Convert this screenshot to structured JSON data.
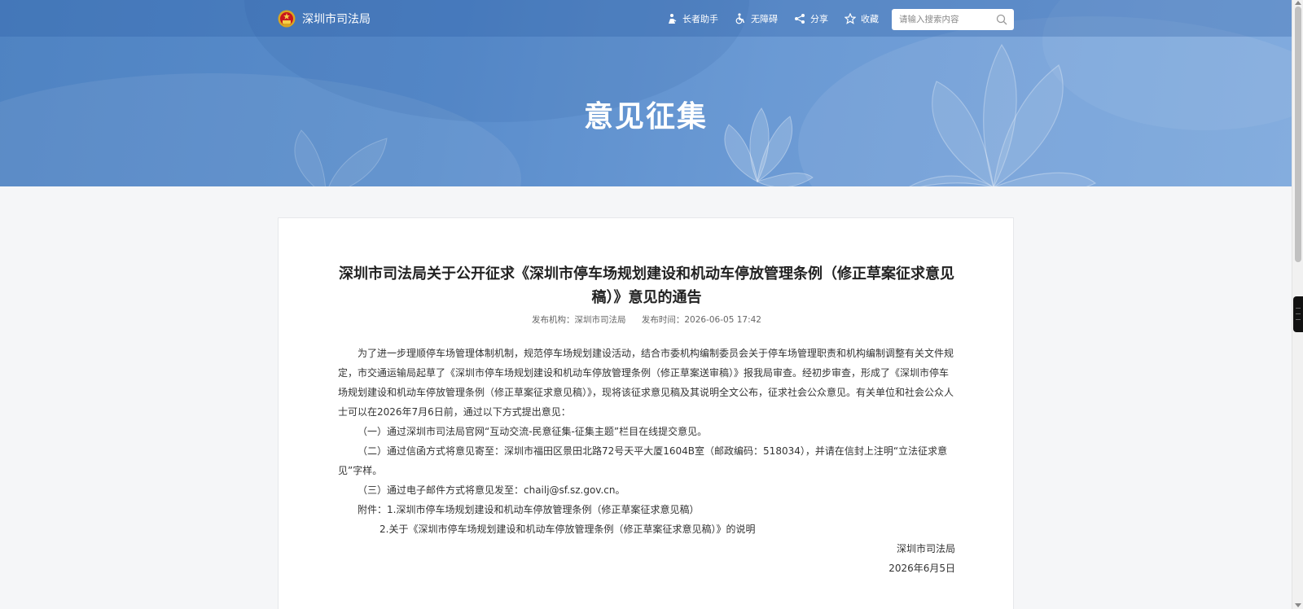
{
  "header": {
    "site_name": "深圳市司法局",
    "tools": [
      {
        "label": "长者助手",
        "icon": "elder-assist-icon"
      },
      {
        "label": "无障碍",
        "icon": "accessibility-icon"
      },
      {
        "label": "分享",
        "icon": "share-icon"
      },
      {
        "label": "收藏",
        "icon": "star-icon"
      }
    ],
    "search": {
      "placeholder": "请输入搜索内容",
      "icon": "search-icon"
    }
  },
  "banner": {
    "title": "意见征集"
  },
  "article": {
    "title": "深圳市司法局关于公开征求《深圳市停车场规划建设和机动车停放管理条例（修正草案征求意见稿）》意见的通告",
    "meta": {
      "publisher_label": "发布机构：",
      "publisher": "深圳市司法局",
      "time_label": "发布时间：",
      "time": "2026-06-05 17:42"
    },
    "intro": "为了进一步理顺停车场管理体制机制，规范停车场规划建设活动，结合市委机构编制委员会关于停车场管理职责和机构编制调整有关文件规定，市交通运输局起草了《深圳市停车场规划建设和机动车停放管理条例（修正草案送审稿）》报我局审查。经初步审查，形成了《深圳市停车场规划建设和机动车停放管理条例（修正草案征求意见稿）》，现将该征求意见稿及其说明全文公布，征求社会公众意见。有关单位和社会公众人士可以在2026年7月6日前，通过以下方式提出意见：",
    "methods": [
      "（一）通过深圳市司法局官网“互动交流-民意征集-征集主题”栏目在线提交意见。",
      "（二）通过信函方式将意见寄至：深圳市福田区景田北路72号天平大厦1604B室（邮政编码：518034），并请在信封上注明“立法征求意见”字样。",
      "（三）通过电子邮件方式将意见发至：chailj@sf.sz.gov.cn。"
    ],
    "attachment_1": "附件：1.深圳市停车场规划建设和机动车停放管理条例（修正草案征求意见稿）",
    "attachment_2": "2.关于《深圳市停车场规划建设和机动车停放管理条例（修正草案征求意见稿）》的说明",
    "signature": "深圳市司法局",
    "date": "2026年6月5日"
  },
  "colors": {
    "banner": "#5a8dcc",
    "topbar": "#3f74b8",
    "card_bg": "#ffffff",
    "page_bg": "#f5f6f8"
  }
}
